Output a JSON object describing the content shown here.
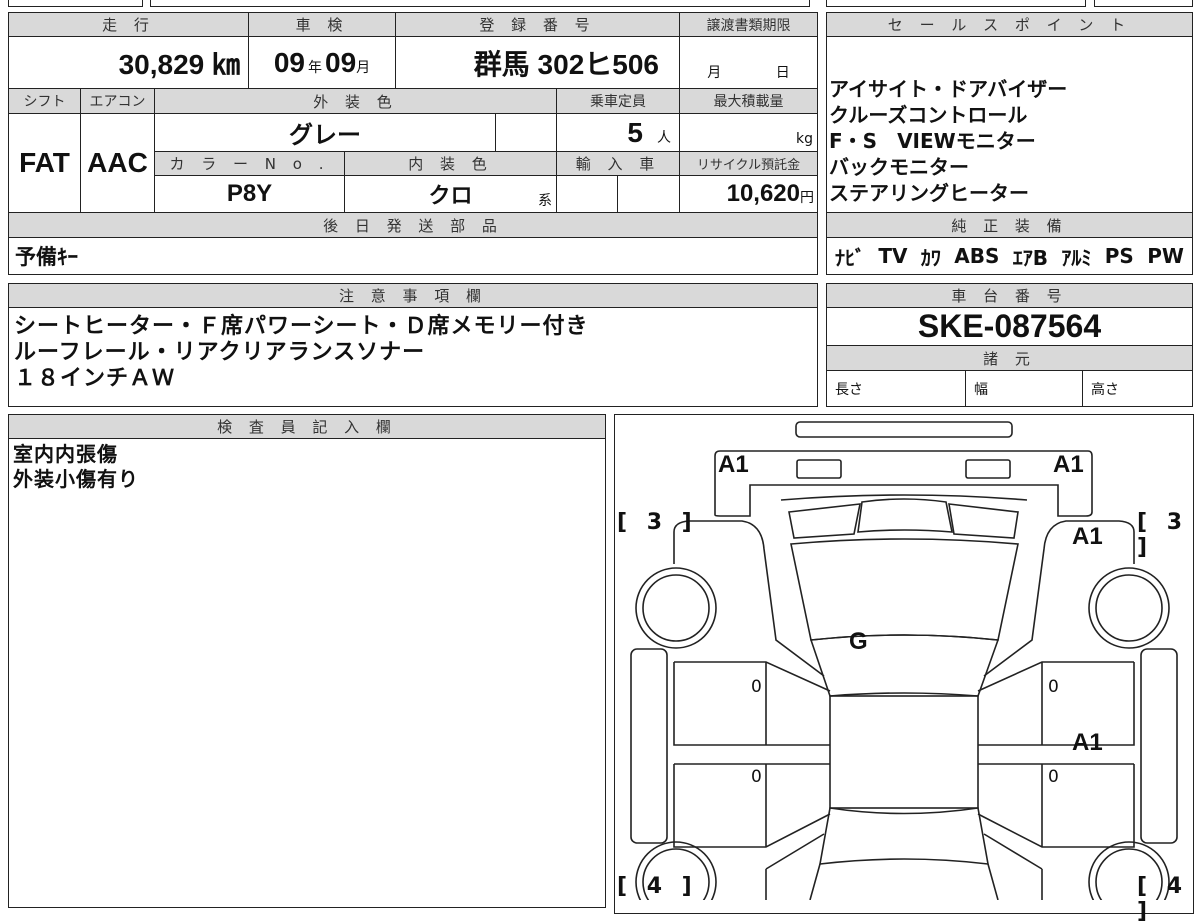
{
  "main": {
    "mileage_h": "走 行",
    "inspection_h": "車 検",
    "reg_h": "登 録 番 号",
    "transfer_h": "譲渡書類期限",
    "mileage": "30,829 ㎞",
    "insp_year": "09",
    "year_unit": "年",
    "insp_month": "09",
    "month_unit": "月",
    "reg": "群馬 302ヒ506",
    "transfer_month": "月",
    "transfer_day": "日",
    "shift_h": "シフト",
    "ac_h": "エアコン",
    "ext_color_h": "外 装 色",
    "capacity_h": "乗車定員",
    "maxload_h": "最大積載量",
    "shift": "FAT",
    "ac": "AAC",
    "ext_color": "グレー",
    "capacity": "5",
    "capacity_unit": "人",
    "maxload_unit": "kg",
    "colorno_h": "カ ラ ー N o .",
    "int_color_h": "内 装 色",
    "import_h": "輸 入 車",
    "recycle_h": "リサイクル預託金",
    "colorno": "P8Y",
    "int_color": "クロ",
    "int_suffix": "系",
    "recycle": "10,620",
    "recycle_unit": "円",
    "later_parts_h": "後 日 発 送 部 品",
    "later_parts": "予備ｷｰ"
  },
  "sales": {
    "header": "セ ー ル ス ポ イ ン ト",
    "lines": [
      "アイサイト・ドアバイザー",
      "クルーズコントロール",
      "F・S　VIEWモニター",
      "バックモニター",
      "ステアリングヒーター"
    ],
    "equip_h": "純 正 装 備",
    "equip": [
      "ﾅﾋﾞ",
      "TV",
      "ｶﾜ",
      "ABS",
      "ｴｱB",
      "ｱﾙﾐ",
      "PS",
      "PW"
    ]
  },
  "notes": {
    "header": "注 意 事 項 欄",
    "lines": [
      "シートヒーター・Ｆ席パワーシート・Ｄ席メモリー付き",
      "ルーフレール・リアクリアランスソナー",
      "１８インチＡＷ"
    ]
  },
  "chassis": {
    "header": "車 台 番 号",
    "value": "SKE-087564",
    "spec_h": "諸 元",
    "length": "長さ",
    "width": "幅",
    "height": "高さ"
  },
  "inspector": {
    "header": "検 査 員 記 入 欄",
    "lines": [
      "室内内張傷",
      "外装小傷有り"
    ]
  },
  "diagram": {
    "marks": [
      "A1",
      "A1",
      "A1",
      "A1",
      "G",
      "0",
      "0",
      "0",
      "0"
    ],
    "brackets": [
      "[ 3 ]",
      "[ 3 ]",
      "[ 4 ]",
      "[ 4 ]"
    ]
  }
}
